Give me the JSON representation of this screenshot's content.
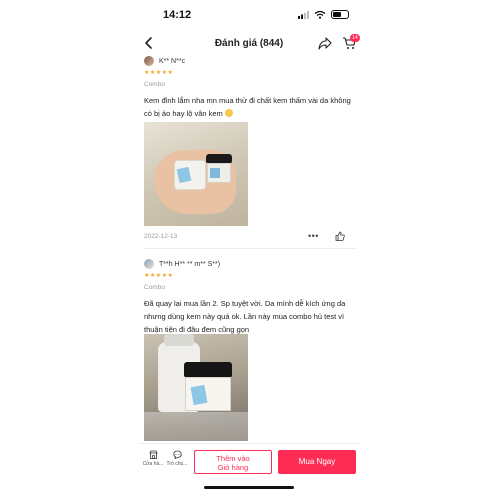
{
  "status_bar": {
    "time": "14:12"
  },
  "header": {
    "title": "Đánh giá (844)",
    "cart_count": "14"
  },
  "reviews": [
    {
      "reviewer": "K** N**c",
      "rating": 5,
      "stars": "★★★★★",
      "variant": "Combo",
      "text": "Kem đỉnh lắm nha mn mua thử đi chất kem thấm vài da không có bị ảo hay lộ vân kem",
      "emoji": "smiling-face",
      "date": "2022-12-13",
      "more": "•••"
    },
    {
      "reviewer": "T**h H** ** m** S**)",
      "rating": 5,
      "stars": "★★★★★",
      "variant": "Combo",
      "text": "Đã quay lại mua lần 2. Sp tuyệt vời. Da mình dễ kích ứng da nhưng dùng kem này quá ok. Lần này mua combo hủ test vì thuận tiện đi đâu đem cũng gọn"
    }
  ],
  "bottom_bar": {
    "shop_label": "Cửa hà...",
    "chat_label": "Trò chu...",
    "add_to_cart_label": "Thêm vào\nGiỏ hàng",
    "buy_now_label": "Mua Ngay"
  },
  "colors": {
    "accent": "#fe2c55",
    "star": "#f5a623"
  }
}
